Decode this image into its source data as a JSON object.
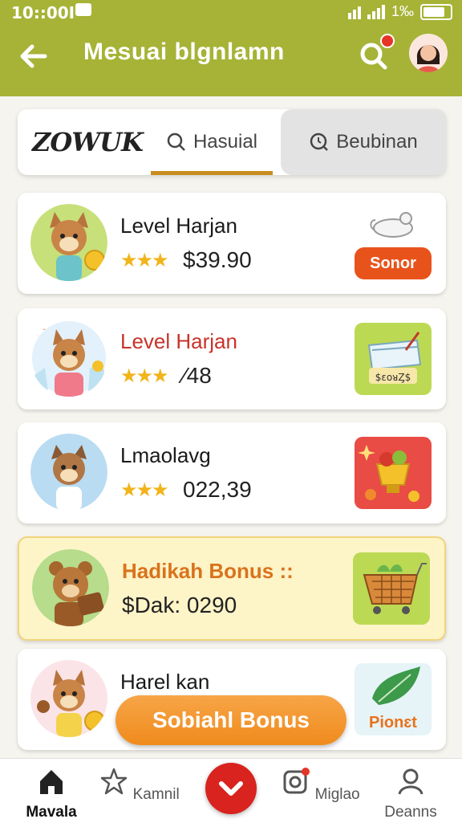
{
  "status": {
    "time": "10::00I",
    "battery": "1‰"
  },
  "header": {
    "title": "Mesuai blgnlamn"
  },
  "tabs": {
    "logo": "ZOWUK",
    "tab1": "Hasuial",
    "tab2": "Beubinan"
  },
  "cards": [
    {
      "title": "Level Harjan",
      "stars": "★★★",
      "price": "$39.90",
      "button": "Sonor"
    },
    {
      "title": "Level Harjan",
      "stars": "★★★",
      "price": "⁄48",
      "image_text": "$ɛoᴚȤ$"
    },
    {
      "title": "Lmaolavg",
      "stars": "★★★",
      "price": "022,39"
    },
    {
      "title": "Hadikah Bonus ::",
      "price": "$Dak: 0290"
    },
    {
      "title": "Harel kan",
      "image_text": "Pionɛt"
    }
  ],
  "cta": {
    "label": "Sobiahl Bonus"
  },
  "nav": {
    "home": "Mavala",
    "kamnil": "Kamnil",
    "miglao": "Miglao",
    "deanns": "Deanns"
  },
  "colors": {
    "header": "#a6b336",
    "accent": "#e8531c",
    "cta": "#ef8b1c",
    "fab": "#d8231e"
  }
}
